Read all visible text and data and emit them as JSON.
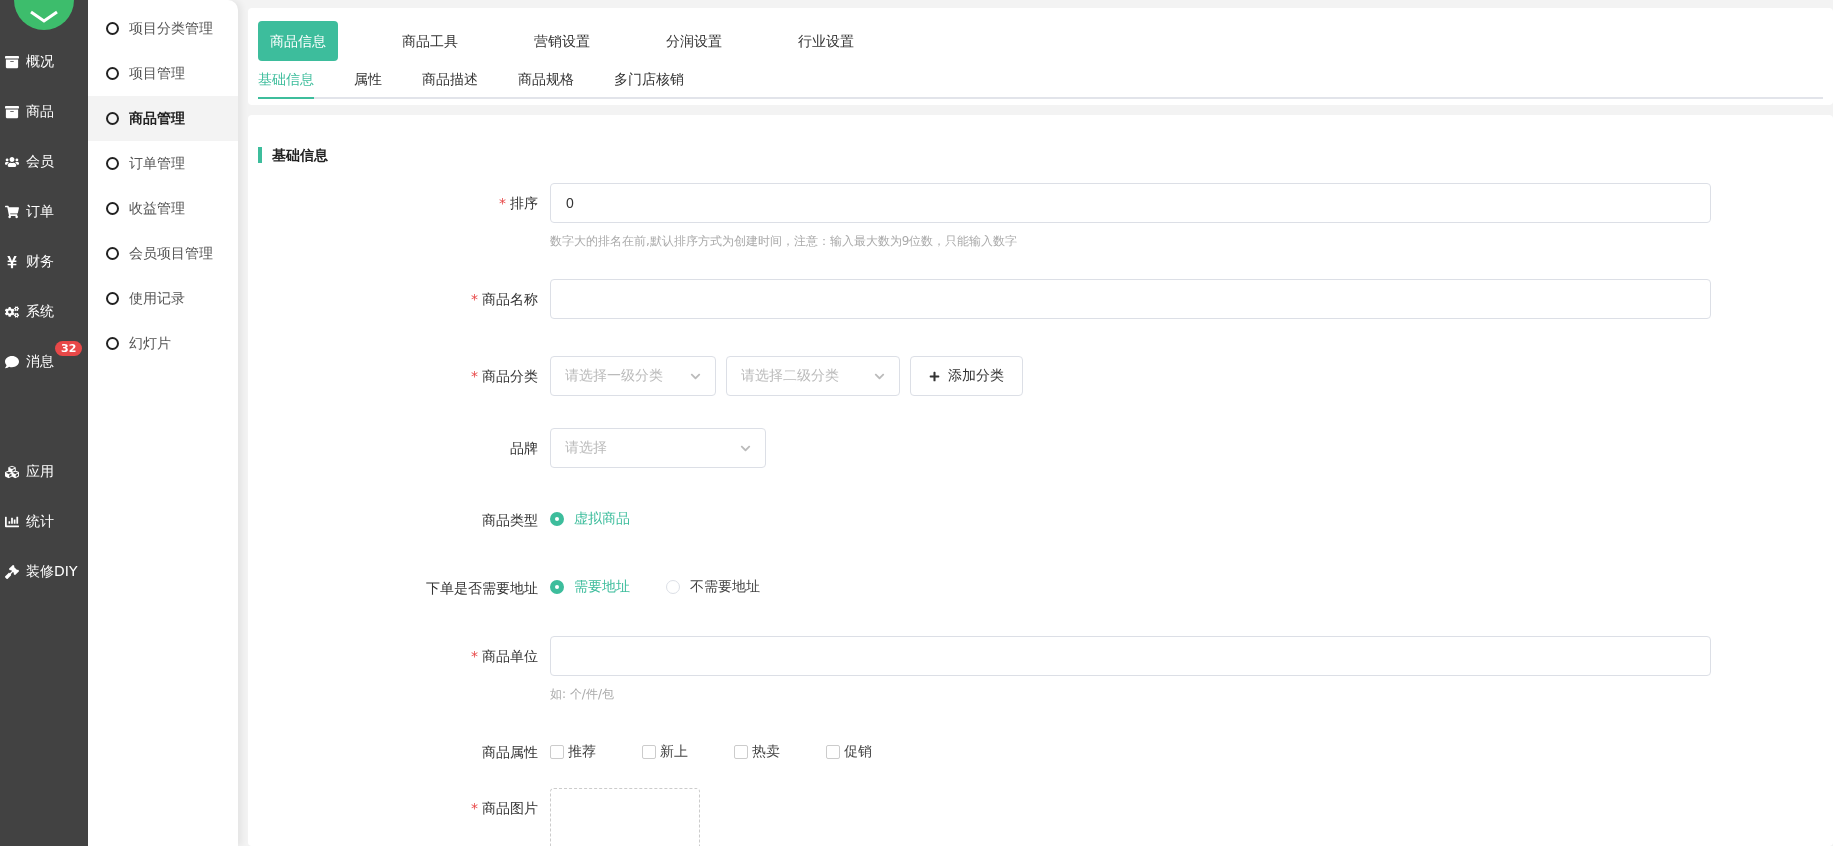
{
  "sidebar": {
    "items": [
      {
        "label": "概况"
      },
      {
        "label": "商品"
      },
      {
        "label": "会员"
      },
      {
        "label": "订单"
      },
      {
        "label": "财务"
      },
      {
        "label": "系统"
      },
      {
        "label": "消息",
        "badge": "32"
      }
    ],
    "apps": [
      {
        "label": "应用"
      },
      {
        "label": "统计"
      },
      {
        "label": "装修DIY"
      }
    ]
  },
  "submenu": {
    "items": [
      {
        "label": "项目分类管理",
        "selected": false
      },
      {
        "label": "项目管理",
        "selected": false
      },
      {
        "label": "商品管理",
        "selected": true
      },
      {
        "label": "订单管理",
        "selected": false
      },
      {
        "label": "收益管理",
        "selected": false
      },
      {
        "label": "会员项目管理",
        "selected": false
      },
      {
        "label": "使用记录",
        "selected": false
      },
      {
        "label": "幻灯片",
        "selected": false
      }
    ]
  },
  "tabs": [
    {
      "label": "商品信息",
      "selected": true
    },
    {
      "label": "商品工具",
      "selected": false
    },
    {
      "label": "营销设置",
      "selected": false
    },
    {
      "label": "分润设置",
      "selected": false
    },
    {
      "label": "行业设置",
      "selected": false
    }
  ],
  "subtabs": [
    {
      "label": "基础信息",
      "selected": true
    },
    {
      "label": "属性",
      "selected": false
    },
    {
      "label": "商品描述",
      "selected": false
    },
    {
      "label": "商品规格",
      "selected": false
    },
    {
      "label": "多门店核销",
      "selected": false
    }
  ],
  "section_title": "基础信息",
  "fields": [
    {
      "kind": "input",
      "label": "排序",
      "mark": "*",
      "value": "0",
      "hint": "数字大的排名在前,默认排序方式为创建时间，注意：输入最大数为9位数，只能输入数字"
    },
    {
      "kind": "input",
      "label": "商品名称",
      "mark": "*"
    },
    {
      "kind": "category",
      "label": "商品分类",
      "mark": "*",
      "selects": [
        {
          "placeholder": "请选择一级分类"
        },
        {
          "placeholder": "请选择二级分类"
        }
      ],
      "button": "添加分类"
    },
    {
      "kind": "select",
      "label": "品牌",
      "placeholder": "请选择"
    },
    {
      "kind": "radio",
      "label": "商品类型",
      "options": [
        {
          "label": "虚拟商品",
          "selected": true
        }
      ]
    },
    {
      "kind": "radio",
      "label": "下单是否需要地址",
      "options": [
        {
          "label": "需要地址",
          "selected": true
        },
        {
          "label": "不需要地址",
          "selected": false
        }
      ]
    },
    {
      "kind": "input",
      "label": "商品单位",
      "mark": "*",
      "hint": "如: 个/件/包"
    },
    {
      "kind": "checkbox",
      "label": "商品属性",
      "options": [
        {
          "label": "推荐",
          "checked": false
        },
        {
          "label": "新上",
          "checked": false
        },
        {
          "label": "热卖",
          "checked": false
        },
        {
          "label": "促销",
          "checked": false
        }
      ]
    },
    {
      "kind": "upload",
      "label": "商品图片",
      "mark": "*"
    }
  ]
}
